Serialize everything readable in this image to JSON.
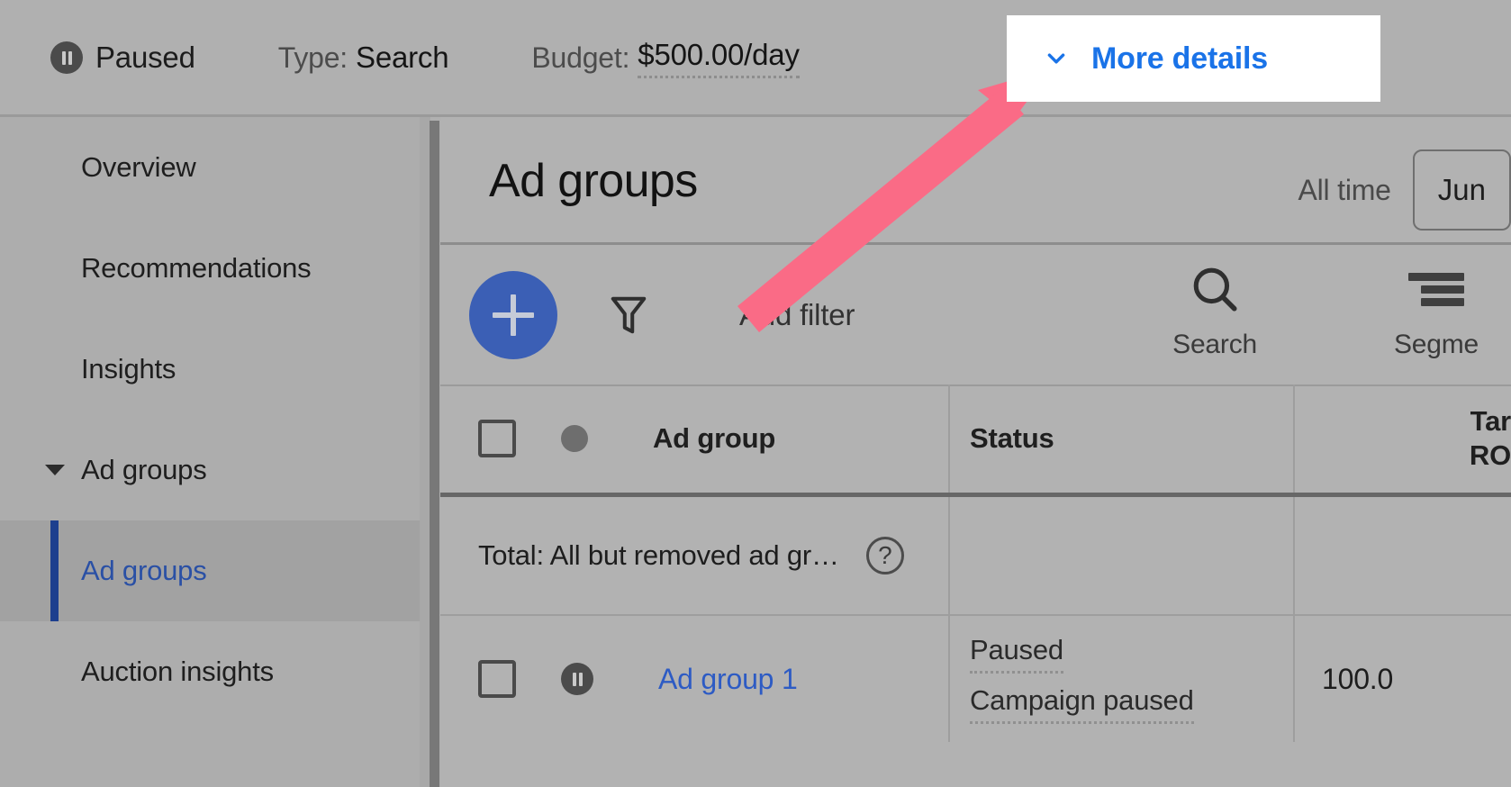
{
  "topbar": {
    "status": {
      "icon": "pause-circle-icon",
      "label": "Paused"
    },
    "type": {
      "label": "Type:",
      "value": "Search"
    },
    "budget": {
      "label": "Budget:",
      "value": "$500.00/day"
    },
    "more_details": {
      "icon": "chevron-down-icon",
      "label": "More details"
    }
  },
  "sidebar": {
    "items": [
      {
        "label": "Overview",
        "level": "level0",
        "selected": false,
        "expandable": false
      },
      {
        "label": "Recommendations",
        "level": "level0",
        "selected": false,
        "expandable": false
      },
      {
        "label": "Insights",
        "level": "level0",
        "selected": false,
        "expandable": false
      },
      {
        "label": "Ad groups",
        "level": "group",
        "selected": false,
        "expandable": true
      },
      {
        "label": "Ad groups",
        "level": "child",
        "selected": true,
        "expandable": false
      },
      {
        "label": "Auction insights",
        "level": "child",
        "selected": false,
        "expandable": false
      }
    ]
  },
  "main": {
    "page_title": "Ad groups",
    "date_range": {
      "all_time_label": "All time",
      "button_value": "Jun"
    },
    "toolbar": {
      "add_button_icon": "plus-icon",
      "filter_icon": "funnel-icon",
      "add_filter_label": "Add filter",
      "search": {
        "icon": "search-icon",
        "label": "Search"
      },
      "segment": {
        "icon": "segment-icon",
        "label": "Segme"
      }
    },
    "table": {
      "columns": [
        {
          "key": "name",
          "label": "Ad group"
        },
        {
          "key": "status",
          "label": "Status"
        },
        {
          "key": "troas",
          "label": "Tar\nRO"
        }
      ],
      "total_row": {
        "label": "Total: All but removed ad gr…",
        "help_icon": "help-circle-icon",
        "status": "",
        "troas": ""
      },
      "rows": [
        {
          "checkbox": false,
          "status_icon": "pause-circle-icon",
          "name": "Ad group 1",
          "status_primary": "Paused",
          "status_secondary": "Campaign paused",
          "troas": "100.0"
        }
      ]
    }
  },
  "annotation": {
    "arrow_color": "#FA6B86",
    "arrow_points_to": "more-details-button"
  },
  "colors": {
    "link_blue": "#2d5bc4",
    "accent_blue": "#1a73e8",
    "fab_blue": "#3b5fb5",
    "nav_accent": "#1d3f8e",
    "page_bg": "#b2b2b2",
    "sidebar_bg": "#adadad",
    "highlight_white": "#ffffff"
  }
}
